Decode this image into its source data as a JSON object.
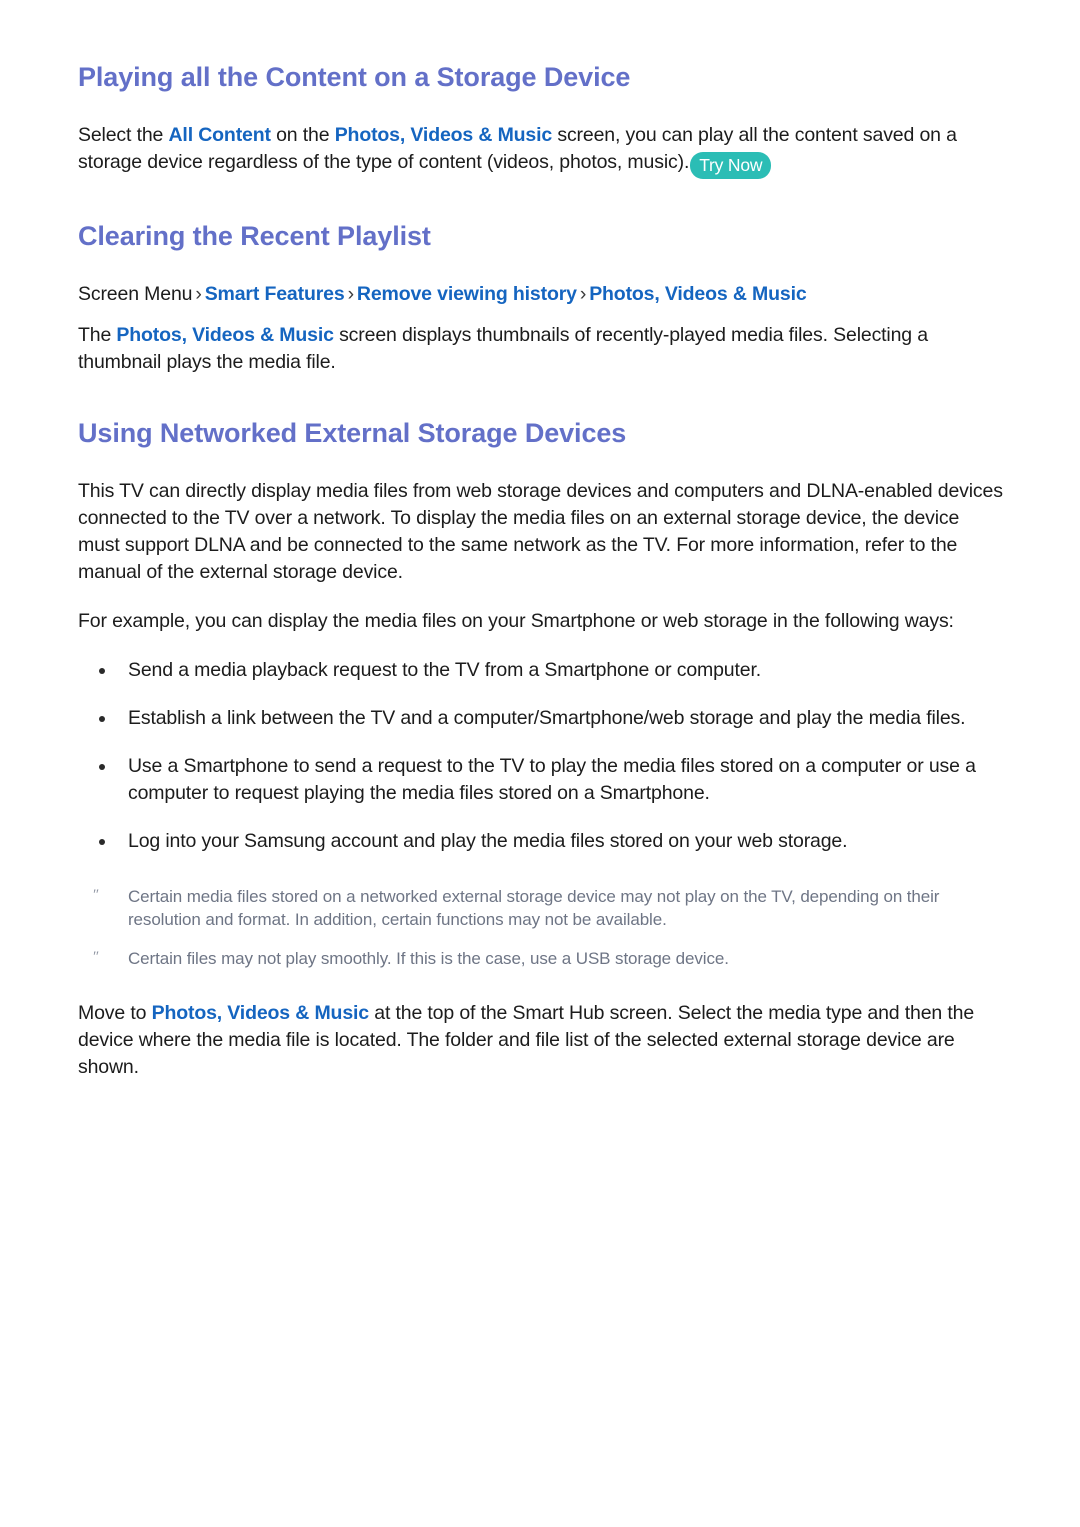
{
  "document": {
    "colors": {
      "heading": "#6370c8",
      "link": "#1565c0",
      "body": "#1c1c1c",
      "note": "#6e7585",
      "badge_bg": "#2bbdb5",
      "badge_text": "#ffffff",
      "background": "#ffffff"
    },
    "sections": [
      {
        "heading": "Playing all the Content on a Storage Device",
        "paragraph": {
          "part1": "Select the ",
          "link1": "All Content",
          "part2": " on the ",
          "link2": "Photos, Videos & Music",
          "part3": " screen, you can play all the content saved on a storage device regardless of the type of content (videos, photos, music).",
          "badge": "Try Now"
        }
      },
      {
        "heading": "Clearing the Recent Playlist",
        "breadcrumb": {
          "root": "Screen Menu",
          "sep": "›",
          "items": [
            "Smart Features",
            "Remove viewing history",
            "Photos, Videos & Music"
          ]
        },
        "paragraph": {
          "part1": "The ",
          "link1": "Photos, Videos & Music",
          "part2": " screen displays thumbnails of recently-played media files. Selecting a thumbnail plays the media file."
        }
      },
      {
        "heading": "Using Networked External Storage Devices",
        "paragraph1": "This TV can directly display media files from web storage devices and computers and DLNA-enabled devices connected to the TV over a network. To display the media files on an external storage device, the device must support DLNA and be connected to the same network as the TV. For more information, refer to the manual of the external storage device.",
        "paragraph2": "For example, you can display the media files on your Smartphone or web storage in the following ways:",
        "bullets": [
          "Send a media playback request to the TV from a Smartphone or computer.",
          "Establish a link between the TV and a computer/Smartphone/web storage and play the media files.",
          "Use a Smartphone to send a request to the TV to play the media files stored on a computer or use a computer to request playing the media files stored on a Smartphone.",
          "Log into your Samsung account and play the media files stored on your web storage."
        ],
        "notes": [
          "Certain media files stored on a networked external storage device may not play on the TV, depending on their resolution and format. In addition, certain functions may not be available.",
          "Certain files may not play smoothly. If this is the case, use a USB storage device."
        ],
        "note_marker": "ʺ",
        "closing_paragraph": {
          "part1": "Move to ",
          "link1": "Photos, Videos & Music",
          "part2": " at the top of the Smart Hub screen. Select the media type and then the device where the media file is located. The folder and file list of the selected external storage device are shown."
        }
      }
    ]
  }
}
